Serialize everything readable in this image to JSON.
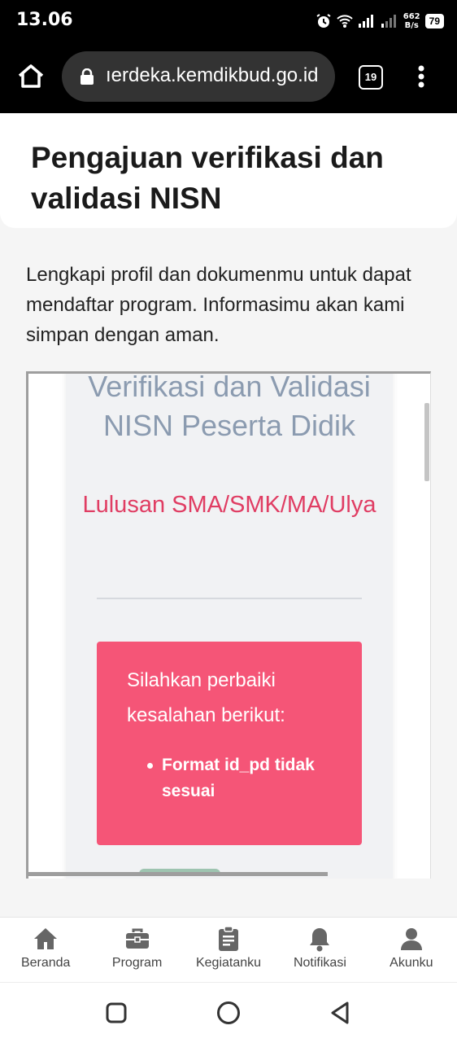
{
  "status_bar": {
    "time": "13.06",
    "net_speed_value": "662",
    "net_speed_unit": "B/s",
    "battery": "79"
  },
  "browser": {
    "url": "ıerdeka.kemdikbud.go.id",
    "tab_count": "19"
  },
  "page": {
    "title": "Pengajuan verifikasi dan validasi NISN",
    "intro": "Lengkapi profil dan dokumenmu untuk dapat mendaftar program. Informasimu akan kami simpan dengan aman."
  },
  "embedded_form": {
    "title": "Verifikasi dan Validasi NISN Peserta Didik",
    "subtitle": "Lulusan SMA/SMK/MA/Ulya",
    "error_message": "Silahkan perbaiki kesalahan berikut:",
    "errors": [
      "Format id_pd tidak sesuai"
    ],
    "colors": {
      "title": "#8b9bb0",
      "subtitle": "#e03d63",
      "error_bg": "#f55577"
    }
  },
  "bottom_nav": {
    "items": [
      {
        "label": "Beranda",
        "icon": "home-icon"
      },
      {
        "label": "Program",
        "icon": "briefcase-icon"
      },
      {
        "label": "Kegiatanku",
        "icon": "clipboard-icon"
      },
      {
        "label": "Notifikasi",
        "icon": "bell-icon"
      },
      {
        "label": "Akunku",
        "icon": "person-icon"
      }
    ]
  },
  "system_nav": {
    "buttons": [
      {
        "icon": "recents-icon"
      },
      {
        "icon": "home-circle-icon"
      },
      {
        "icon": "back-icon"
      }
    ]
  }
}
